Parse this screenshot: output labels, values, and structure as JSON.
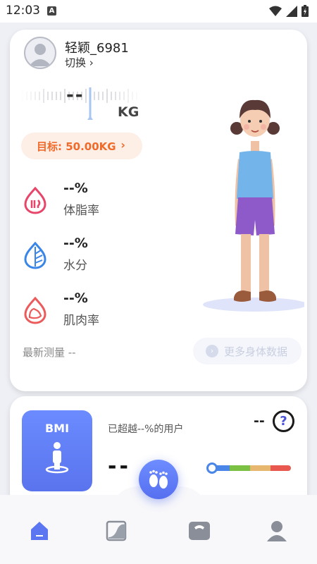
{
  "status_bar": {
    "time": "12:03",
    "a_icon": "A"
  },
  "user": {
    "name": "轻颖_6981",
    "switch_label": "切换 ›"
  },
  "weight": {
    "value": "--",
    "unit": "KG"
  },
  "target": {
    "label": "目标: 50.00KG",
    "chevron": "›"
  },
  "metrics": [
    {
      "value": "--%",
      "label": "体脂率",
      "icon": "body-fat-icon",
      "color": "#e8456b"
    },
    {
      "value": "--%",
      "label": "水分",
      "icon": "water-leaf-icon",
      "color": "#3a86e8"
    },
    {
      "value": "--%",
      "label": "肌肉率",
      "icon": "muscle-icon",
      "color": "#ec5b5b"
    }
  ],
  "latest_measure": "最新测量 --",
  "more_button": "更多身体数据",
  "bmi": {
    "title": "BMI",
    "value": "--",
    "exceed_text": "已超越--%的用户",
    "status_value": "--",
    "help": "?",
    "scale_colors": [
      "#4a86e8",
      "#7ac143",
      "#e7b66f",
      "#e8584e"
    ]
  },
  "bottom_nav": [
    {
      "name": "home",
      "icon": "home-icon",
      "active": true
    },
    {
      "name": "trend",
      "icon": "chart-icon",
      "active": false
    },
    {
      "name": "scale",
      "icon": "scale-icon",
      "active": false
    },
    {
      "name": "profile",
      "icon": "person-icon",
      "active": false
    }
  ],
  "colors": {
    "accent": "#5a74ee",
    "target_text": "#f06a2a",
    "target_bg": "#fdeee6"
  }
}
